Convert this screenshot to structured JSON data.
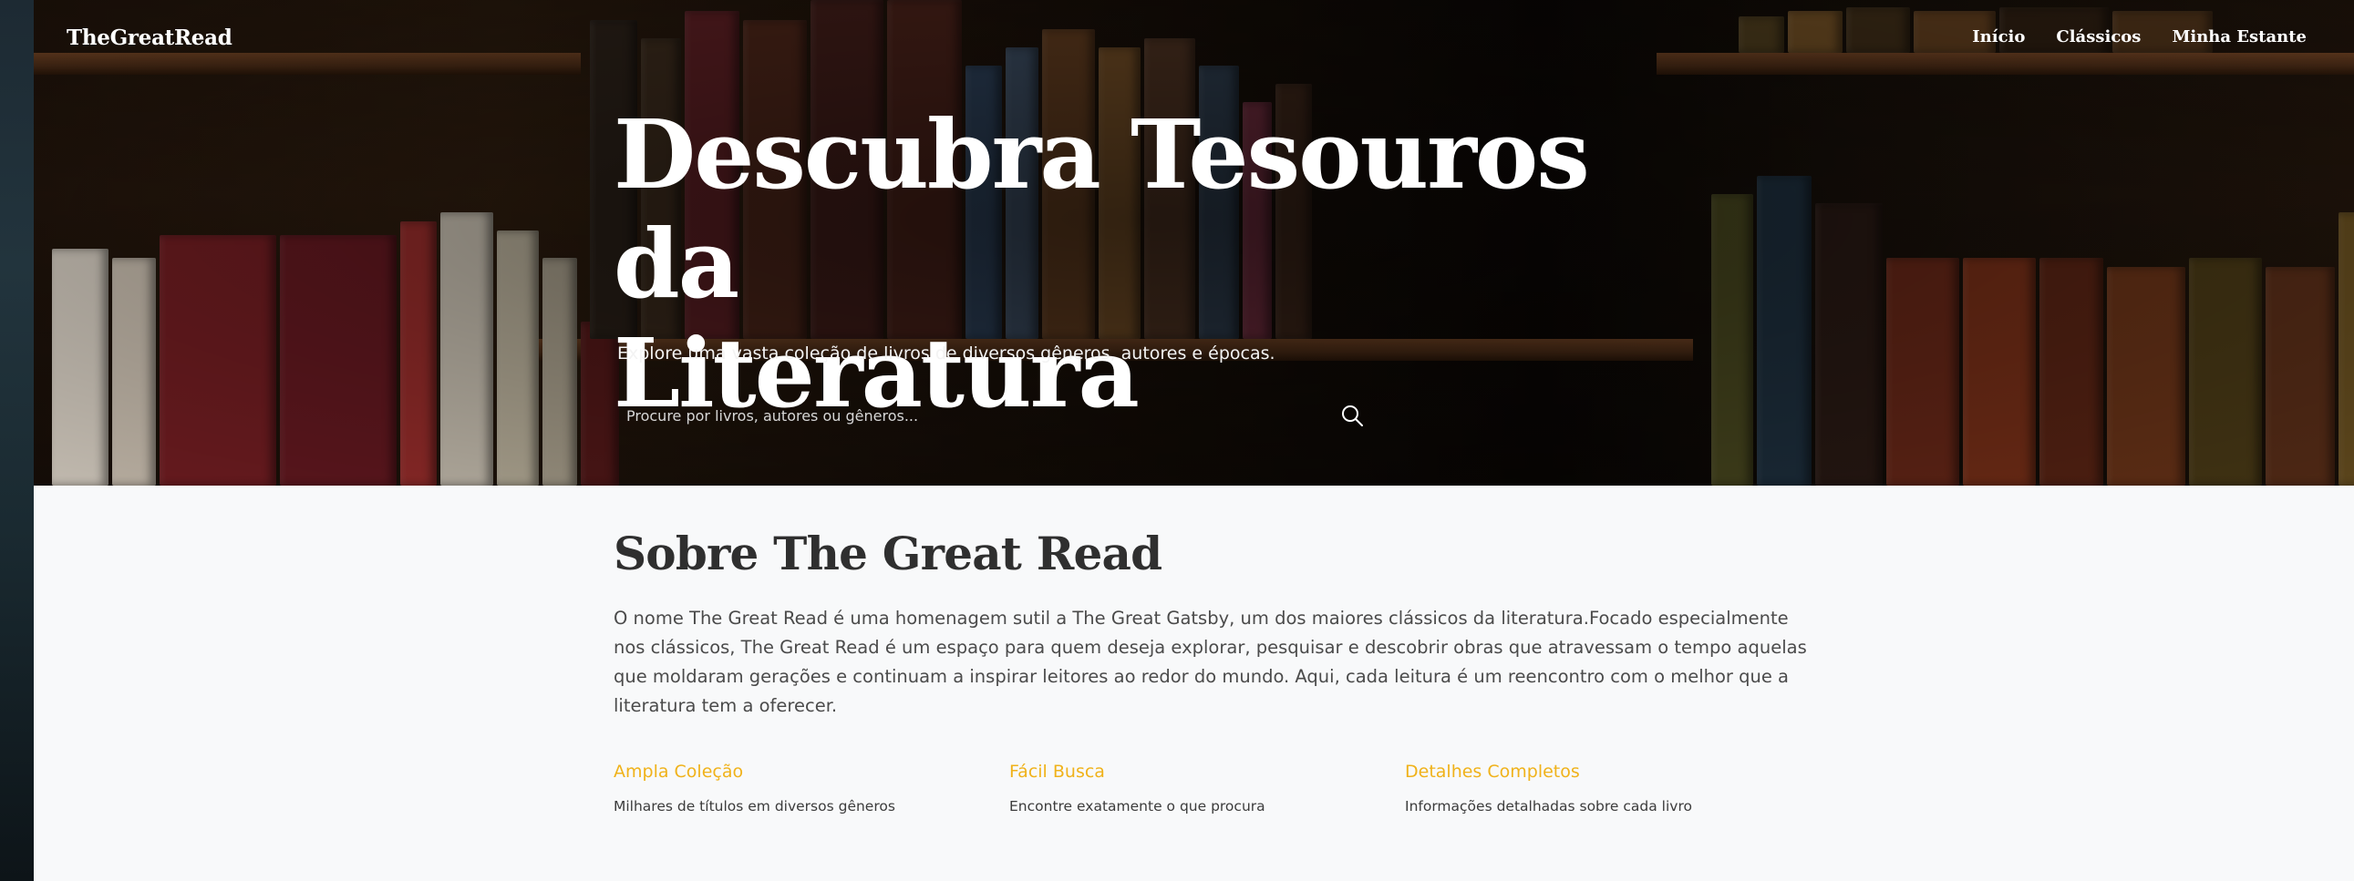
{
  "header": {
    "brand": "TheGreatRead",
    "nav": [
      {
        "label": "Início"
      },
      {
        "label": "Clássicos"
      },
      {
        "label": "Minha Estante"
      }
    ]
  },
  "hero": {
    "title_line1": "Descubra Tesouros da",
    "title_line2": "Literatura",
    "subtitle": "Explore uma vasta coleção de livros de diversos gêneros, autores e épocas.",
    "search": {
      "placeholder": "Procure por livros, autores ou gêneros...",
      "value": "",
      "icon": "search-icon"
    }
  },
  "about": {
    "title": "Sobre The Great Read",
    "text": "O nome The Great Read é uma homenagem sutil a The Great Gatsby, um dos maiores clássicos da literatura.Focado especialmente nos clássicos, The Great Read é um espaço para quem deseja explorar, pesquisar e descobrir obras que atravessam o tempo aquelas que moldaram gerações e continuam a inspirar leitores ao redor do mundo. Aqui, cada leitura é um reencontro com o melhor que a literatura tem a oferecer.",
    "features": [
      {
        "title": "Ampla Coleção",
        "desc": "Milhares de títulos em diversos gêneros"
      },
      {
        "title": "Fácil Busca",
        "desc": "Encontre exatamente o que procura"
      },
      {
        "title": "Detalhes Completos",
        "desc": "Informações detalhadas sobre cada livro"
      }
    ]
  },
  "colors": {
    "accent": "#f0b21a",
    "heading": "#2f2f2f",
    "body_text": "#4b4b4b",
    "page_bg": "#f8f9fa"
  }
}
